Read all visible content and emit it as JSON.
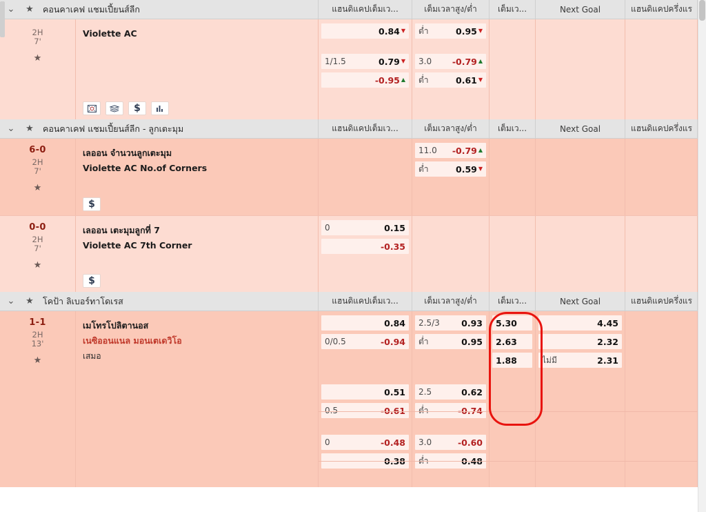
{
  "columns": {
    "handicap_ft": "แฮนดิแคปเต็มเว...",
    "overunder_ft": "เต็มเวลาสูง/ต่ำ",
    "ft_short": "เต็มเว...",
    "next_goal": "Next Goal",
    "handicap_ht": "แฮนดิแคปครึ่งแร"
  },
  "icons": {
    "chevron": "⌄",
    "star": "★",
    "tri_down": "▼",
    "tri_up": "▲",
    "dollar": "$"
  },
  "sections": [
    {
      "id": "concacaf-champions",
      "title": "คอนคาเคฟ แชมเปี้ยนส์ลีก",
      "matches": [
        {
          "id": "violette-ac",
          "tint": "tint-a",
          "score": "",
          "period": "2H",
          "minute": "7'",
          "team_home": "Violette AC",
          "team_away": "",
          "draw": "",
          "has_icon_bar": true,
          "icon_bar": [
            "video-icon",
            "layers-icon",
            "dollar-icon",
            "stats-icon"
          ],
          "odds": {
            "handicap_ft": [
              {
                "left": "",
                "value": "0.84",
                "arrow": "down",
                "neg": false
              },
              {
                "blank": true
              },
              {
                "left": "1/1.5",
                "value": "0.79",
                "arrow": "down",
                "neg": false
              },
              {
                "left": "",
                "value": "-0.95",
                "arrow": "up",
                "neg": true
              }
            ],
            "overunder_ft": [
              {
                "left": "ต่ำ",
                "value": "0.95",
                "arrow": "down",
                "neg": false
              },
              {
                "blank": true
              },
              {
                "left": "3.0",
                "value": "-0.79",
                "arrow": "up",
                "neg": true
              },
              {
                "left": "ต่ำ",
                "value": "0.61",
                "arrow": "down",
                "neg": false
              }
            ],
            "ft_short": [],
            "next_goal": [],
            "handicap_ht": []
          }
        }
      ]
    },
    {
      "id": "concacaf-corners",
      "title": "คอนคาเคฟ แชมเปี้ยนส์ลีก - ลูกเตะมุม",
      "matches": [
        {
          "id": "violette-corners",
          "tint": "tint-b",
          "score": "6-0",
          "period": "2H",
          "minute": "7'",
          "team_home": "เลออน จำนวนลูกเตะมุม",
          "team_away": "Violette AC No.of Corners",
          "draw": "",
          "has_icon_bar": true,
          "icon_bar": [
            "dollar-icon"
          ],
          "odds": {
            "handicap_ft": [],
            "overunder_ft": [
              {
                "left": "11.0",
                "value": "-0.79",
                "arrow": "up",
                "neg": true
              },
              {
                "left": "ต่ำ",
                "value": "0.59",
                "arrow": "down",
                "neg": false
              }
            ],
            "ft_short": [],
            "next_goal": [],
            "handicap_ht": []
          }
        },
        {
          "id": "violette-7th-corner",
          "tint": "tint-a",
          "score": "0-0",
          "period": "2H",
          "minute": "7'",
          "team_home": "เลออน เตะมุมลูกที่ 7",
          "team_away": "Violette AC 7th Corner",
          "draw": "",
          "has_icon_bar": true,
          "icon_bar": [
            "dollar-icon"
          ],
          "odds": {
            "handicap_ft": [
              {
                "left": "0",
                "value": "0.15",
                "arrow": "",
                "neg": false
              },
              {
                "left": "",
                "value": "-0.35",
                "arrow": "",
                "neg": true
              }
            ],
            "overunder_ft": [],
            "ft_short": [],
            "next_goal": [],
            "handicap_ht": []
          }
        }
      ]
    },
    {
      "id": "copa-libertadores",
      "title": "โคป้า ลิเบอร์ทาโดเรส",
      "matches": [
        {
          "id": "metropolitanos-nacional",
          "tint": "tint-b",
          "score": "1-1",
          "period": "2H",
          "minute": "13'",
          "team_home": "เมโทรโปลิตานอส",
          "team_away": "เนซิออนแนล มอนเตเดวิโอ",
          "draw": "เสมอ",
          "has_icon_bar": false,
          "icon_bar": [],
          "odds": {
            "handicap_ft": [
              {
                "left": "",
                "value": "0.84",
                "arrow": "",
                "neg": false
              },
              {
                "left": "0/0.5",
                "value": "-0.94",
                "arrow": "",
                "neg": true
              },
              {
                "blank": true
              },
              {
                "blank": true
              },
              {
                "left": "",
                "value": "0.51",
                "arrow": "",
                "neg": false
              },
              {
                "left": "0.5",
                "value": "-0.61",
                "arrow": "",
                "neg": true
              },
              {
                "blank": true
              },
              {
                "left": "0",
                "value": "-0.48",
                "arrow": "",
                "neg": true
              },
              {
                "left": "",
                "value": "0.38",
                "arrow": "",
                "neg": false
              }
            ],
            "overunder_ft": [
              {
                "left": "2.5/3",
                "value": "0.93",
                "arrow": "",
                "neg": false
              },
              {
                "left": "ต่ำ",
                "value": "0.95",
                "arrow": "",
                "neg": false
              },
              {
                "blank": true
              },
              {
                "blank": true
              },
              {
                "left": "2.5",
                "value": "0.62",
                "arrow": "",
                "neg": false
              },
              {
                "left": "ต่ำ",
                "value": "-0.74",
                "arrow": "",
                "neg": true
              },
              {
                "blank": true
              },
              {
                "left": "3.0",
                "value": "-0.60",
                "arrow": "",
                "neg": true
              },
              {
                "left": "ต่ำ",
                "value": "0.48",
                "arrow": "",
                "neg": false
              }
            ],
            "ft_short": [
              {
                "left": "5.30",
                "value": "",
                "arrow": "",
                "neg": false,
                "leftonly": true
              },
              {
                "left": "2.63",
                "value": "",
                "arrow": "",
                "neg": false,
                "leftonly": true
              },
              {
                "left": "1.88",
                "value": "",
                "arrow": "",
                "neg": false,
                "leftonly": true
              }
            ],
            "next_goal": [
              {
                "left": "",
                "value": "4.45",
                "arrow": "",
                "neg": false
              },
              {
                "left": "",
                "value": "2.32",
                "arrow": "",
                "neg": false
              },
              {
                "left": "ไม่มี",
                "value": "2.31",
                "arrow": "",
                "neg": false
              }
            ],
            "handicap_ht": []
          }
        }
      ]
    }
  ],
  "annotation": {
    "type": "red-ellipse-highlight",
    "target_column": "เต็มเว...",
    "color": "#e8140f"
  }
}
